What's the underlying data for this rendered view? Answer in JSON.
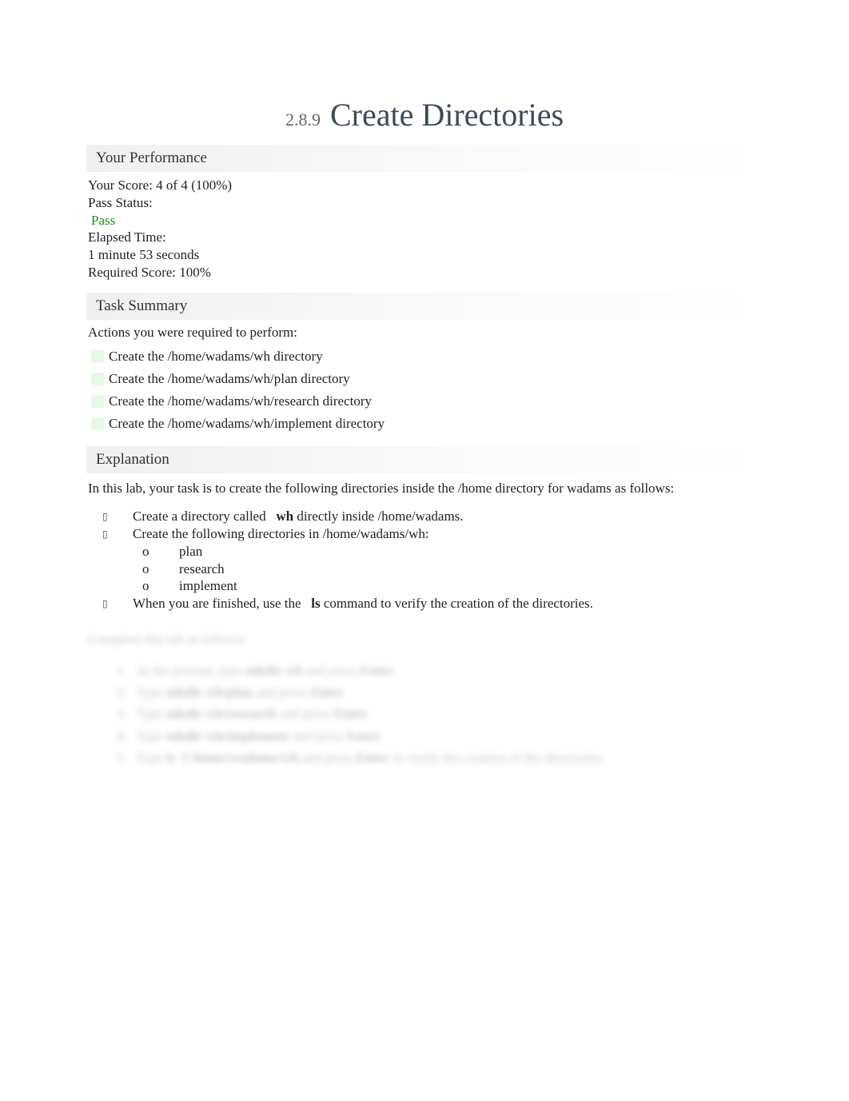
{
  "title": {
    "number": "2.8.9",
    "text": "Create Directories"
  },
  "sections": {
    "performance": {
      "header": "Your Performance",
      "score_line": "Your Score: 4 of 4 (100%)",
      "pass_status_label": "Pass Status:",
      "pass_status_value": "Pass",
      "elapsed_label": "Elapsed Time:",
      "elapsed_value": "1 minute 53 seconds",
      "required_score": "Required Score: 100%"
    },
    "task_summary": {
      "header": "Task Summary",
      "intro": "Actions you were required to perform:",
      "items": [
        "Create the /home/wadams/wh directory",
        "Create the /home/wadams/wh/plan directory",
        "Create the /home/wadams/wh/research directory",
        "Create the /home/wadams/wh/implement directory"
      ]
    },
    "explanation": {
      "header": "Explanation",
      "intro": "In this lab, your task is to create the following directories inside the /home directory for wadams as follows:",
      "bullets": [
        {
          "pre": "Create a directory called ",
          "bold": "wh",
          "post": " directly inside /home/wadams."
        },
        {
          "pre": "Create the following directories in /home/wadams/wh:",
          "bold": "",
          "post": ""
        }
      ],
      "subitems": [
        "plan",
        "research",
        "implement"
      ],
      "finish": {
        "pre": "When you are finished, use the ",
        "bold": "ls",
        "post": " command to verify the creation of the directories."
      },
      "hidden_intro": "Complete this lab as follows:",
      "steps": [
        {
          "n": "1.",
          "pre": "At the prompt, type ",
          "bold": "mkdir wh",
          "post": " and press ",
          "bold2": "Enter",
          "post2": "."
        },
        {
          "n": "2.",
          "pre": "Type ",
          "bold": "mkdir wh/plan",
          "post": " and press ",
          "bold2": "Enter",
          "post2": "."
        },
        {
          "n": "3.",
          "pre": "Type ",
          "bold": "mkdir wh/research",
          "post": " and press ",
          "bold2": "Enter",
          "post2": "."
        },
        {
          "n": "4.",
          "pre": "Type ",
          "bold": "mkdir wh/implement",
          "post": " and press ",
          "bold2": "Enter",
          "post2": "."
        },
        {
          "n": "5.",
          "pre": "Type ",
          "bold": "ls -l /home/wadams/wh",
          "post": " and press ",
          "bold2": "Enter",
          "post2": " to verify the creation of the directories."
        }
      ]
    }
  }
}
